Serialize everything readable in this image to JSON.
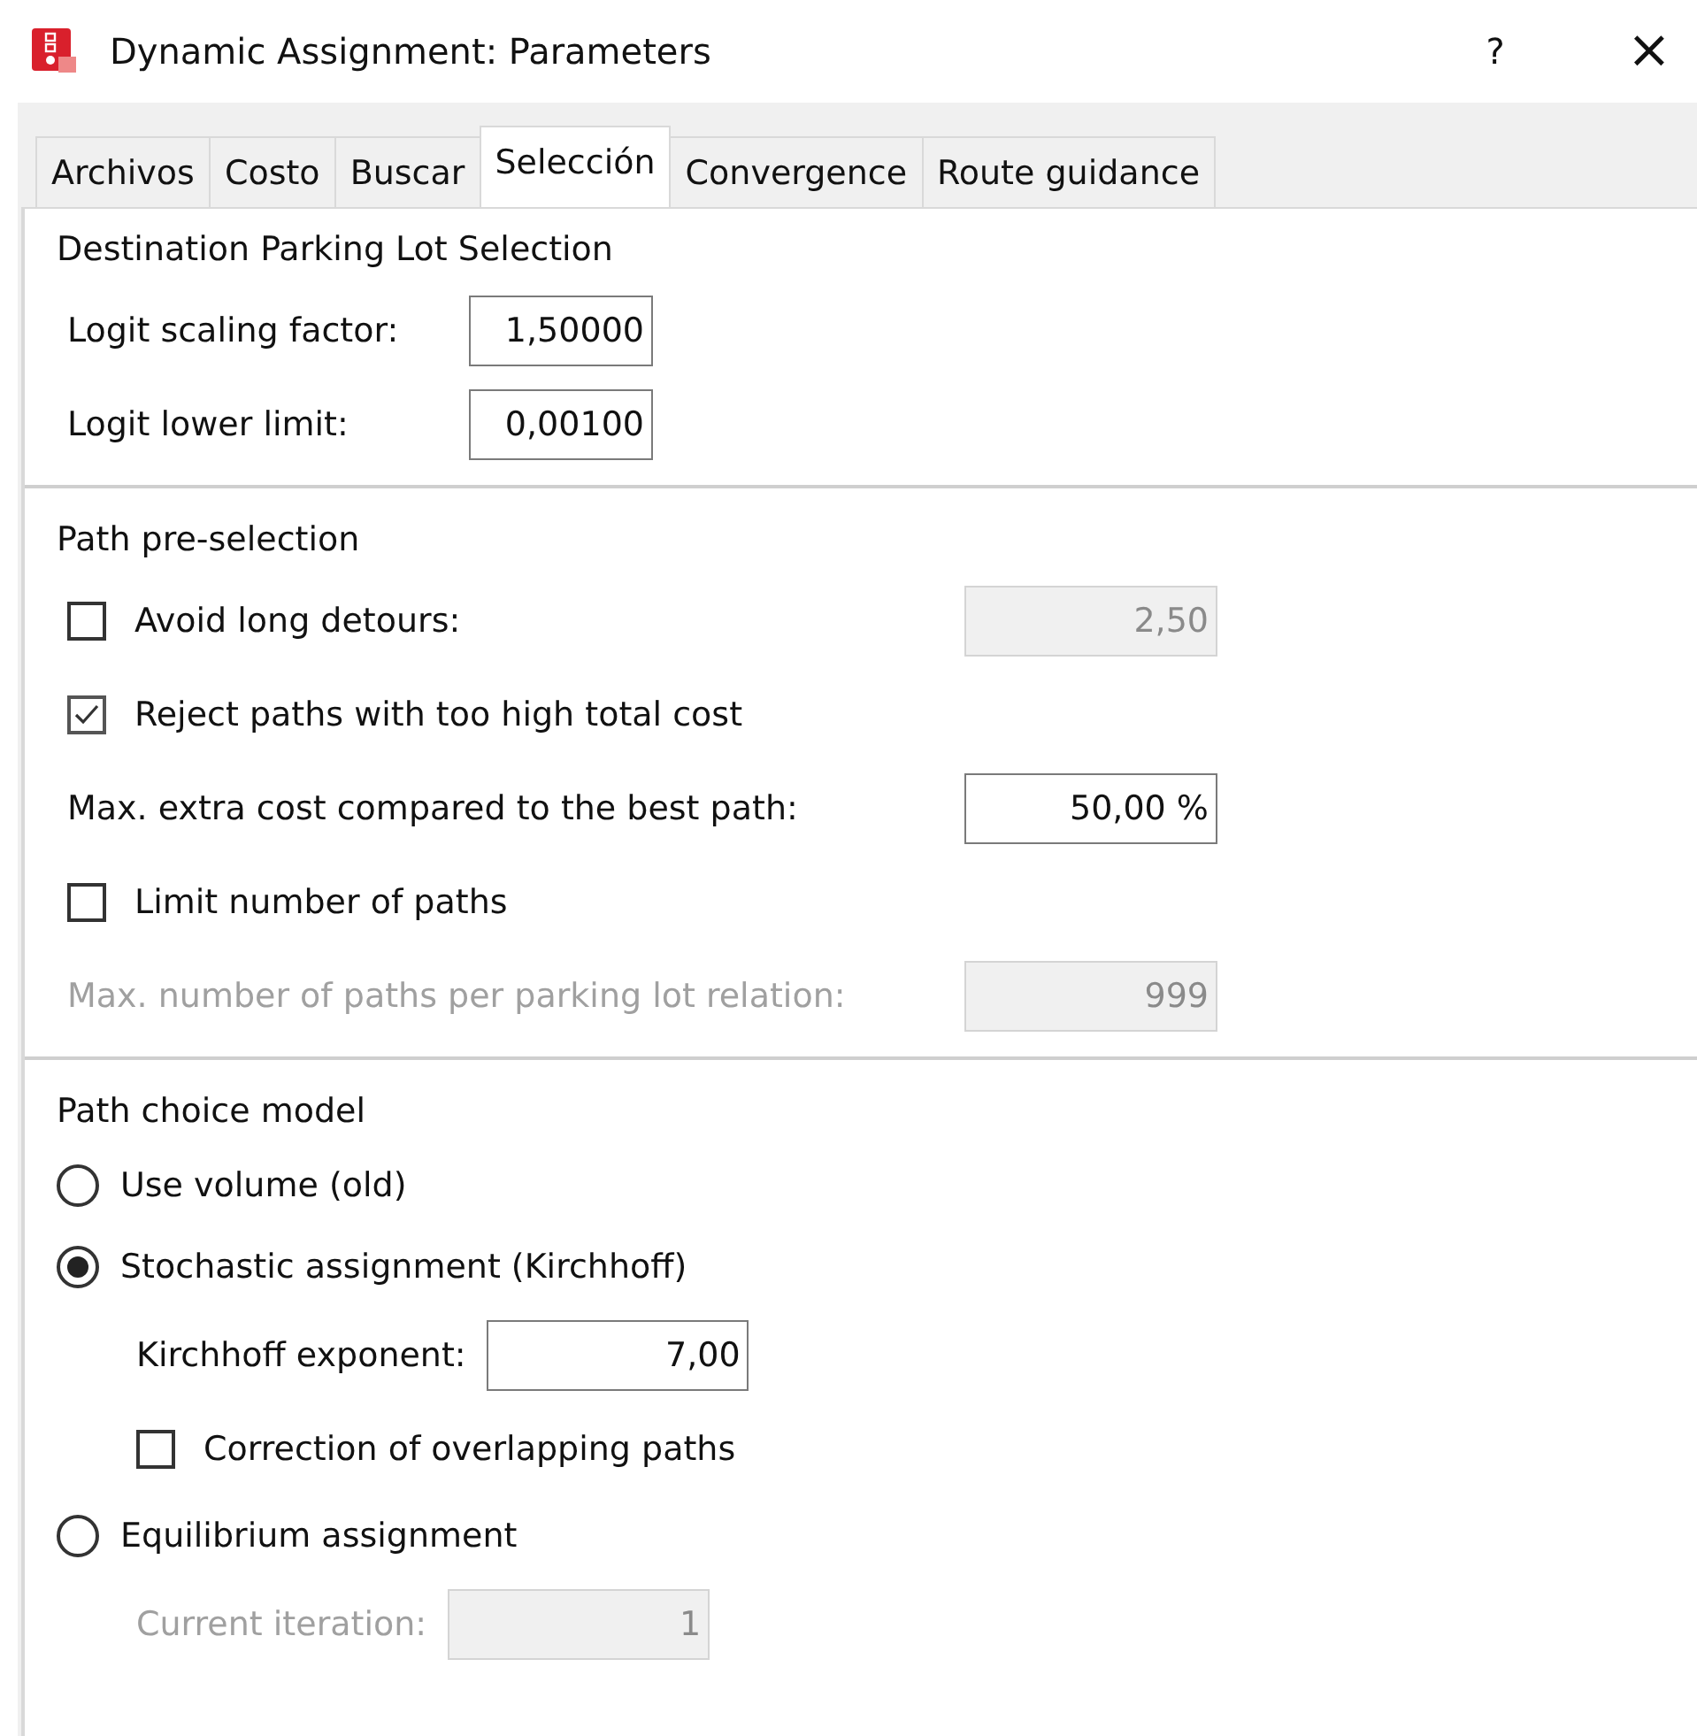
{
  "window": {
    "title": "Dynamic Assignment: Parameters",
    "help_button": "?",
    "close_button": "×"
  },
  "tabs": [
    {
      "label": "Archivos",
      "selected": false
    },
    {
      "label": "Costo",
      "selected": false
    },
    {
      "label": "Buscar",
      "selected": false
    },
    {
      "label": "Selección",
      "selected": true
    },
    {
      "label": "Convergence",
      "selected": false
    },
    {
      "label": "Route guidance",
      "selected": false
    }
  ],
  "sections": [
    {
      "heading": "Destination Parking Lot Selection",
      "rows": [
        {
          "kind": "field",
          "label": "Logit scaling factor:",
          "value": "1,50000",
          "disabled": false
        },
        {
          "kind": "field",
          "label": "Logit lower limit:",
          "value": "0,00100",
          "disabled": false
        }
      ]
    },
    {
      "heading": "Path pre-selection",
      "rows": [
        {
          "kind": "checkbox",
          "label": "Avoid long detours:",
          "checked": false,
          "value": "2,50",
          "disabled": true
        },
        {
          "kind": "checkbox",
          "label": "Reject paths with too high total cost",
          "checked": true
        },
        {
          "kind": "field",
          "label": "Max. extra cost compared to the best path:",
          "value": "50,00 %",
          "disabled": false
        },
        {
          "kind": "checkbox",
          "label": "Limit number of paths",
          "checked": false
        },
        {
          "kind": "field",
          "label": "Max. number of paths per parking lot relation:",
          "value": "999",
          "disabled": true
        }
      ]
    },
    {
      "heading": "Path choice model",
      "rows": [
        {
          "kind": "radio",
          "label": "Use volume (old)",
          "selected": false
        },
        {
          "kind": "radio",
          "label": "Stochastic assignment (Kirchhoff)",
          "selected": true,
          "children": [
            {
              "kind": "field",
              "label": "Kirchhoff exponent:",
              "value": "7,00",
              "disabled": false
            },
            {
              "kind": "checkbox",
              "label": "Correction of overlapping paths",
              "checked": false
            }
          ]
        },
        {
          "kind": "radio",
          "label": "Equilibrium assignment",
          "selected": false,
          "children": [
            {
              "kind": "field",
              "label": "Current iteration:",
              "value": "1",
              "disabled": true
            }
          ]
        }
      ]
    }
  ]
}
